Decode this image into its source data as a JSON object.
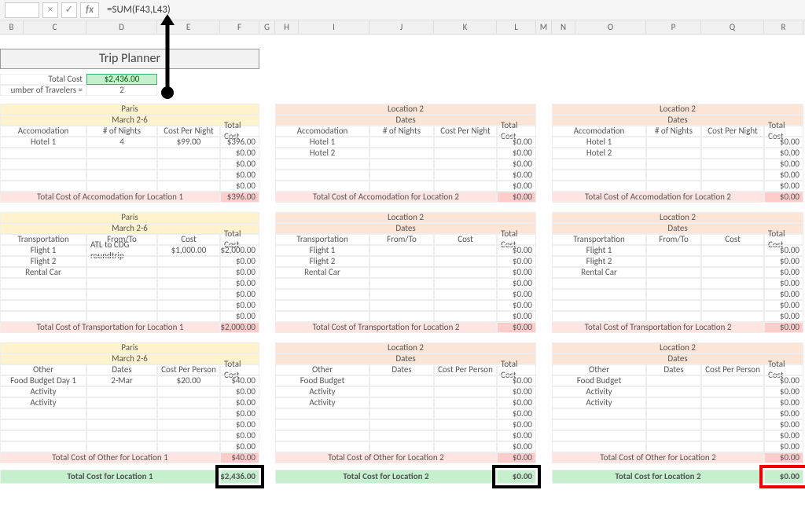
{
  "formula_bar": {
    "cell_ref": "",
    "formula": "=SUM(F43,L43)"
  },
  "columns": [
    "B",
    "C",
    "D",
    "E",
    "F",
    "G",
    "H",
    "I",
    "J",
    "K",
    "L",
    "M",
    "N",
    "O",
    "P",
    "Q",
    "R"
  ],
  "title": "Trip Planner",
  "summary": {
    "total_cost_label": "Total Cost",
    "total_cost": "$2,436.00",
    "travelers_label": "umber of Travelers  =",
    "travelers": "2"
  },
  "blocks": {
    "loc1_acc": {
      "loc": "Paris",
      "dates": "March 2-6",
      "h": [
        "Accomodation",
        "# of Nights",
        "Cost Per Night",
        "Total Cost"
      ],
      "rows": [
        [
          "Hotel 1",
          "4",
          "$99.00",
          "$396.00"
        ],
        [
          "",
          "",
          "",
          "$0.00"
        ],
        [
          "",
          "",
          "",
          "$0.00"
        ],
        [
          "",
          "",
          "",
          "$0.00"
        ],
        [
          "",
          "",
          "",
          "$0.00"
        ]
      ],
      "sub": "Total Cost of Accomodation for Location 1",
      "subv": "$396.00"
    },
    "loc2_acc": {
      "loc": "Location 2",
      "dates": "Dates",
      "h": [
        "Accomodation",
        "# of Nights",
        "Cost Per Night",
        "Total Cost"
      ],
      "rows": [
        [
          "Hotel 1",
          "",
          "",
          "$0.00"
        ],
        [
          "Hotel 2",
          "",
          "",
          "$0.00"
        ],
        [
          "",
          "",
          "",
          "$0.00"
        ],
        [
          "",
          "",
          "",
          "$0.00"
        ],
        [
          "",
          "",
          "",
          "$0.00"
        ]
      ],
      "sub": "Total Cost of Accomodation for Location 2",
      "subv": "$0.00"
    },
    "loc3_acc": {
      "loc": "Location 2",
      "dates": "Dates",
      "h": [
        "Accomodation",
        "# of Nights",
        "Cost Per Night",
        "Total Cost"
      ],
      "rows": [
        [
          "Hotel 1",
          "",
          "",
          "$0.00"
        ],
        [
          "Hotel 2",
          "",
          "",
          "$0.00"
        ],
        [
          "",
          "",
          "",
          "$0.00"
        ],
        [
          "",
          "",
          "",
          "$0.00"
        ],
        [
          "",
          "",
          "",
          "$0.00"
        ]
      ],
      "sub": "Total Cost of Accomodation for Location 2",
      "subv": "$0.00"
    },
    "loc1_tr": {
      "loc": "Paris",
      "dates": "March 2-6",
      "h": [
        "Transportation",
        "From/To",
        "Cost",
        "Total Cost"
      ],
      "rows": [
        [
          "Flight 1",
          "ATL to CDG roundtrip",
          "$1,000.00",
          "$2,000.00"
        ],
        [
          "Flight 2",
          "",
          "",
          "$0.00"
        ],
        [
          "Rental Car",
          "",
          "",
          "$0.00"
        ],
        [
          "",
          "",
          "",
          "$0.00"
        ],
        [
          "",
          "",
          "",
          "$0.00"
        ],
        [
          "",
          "",
          "",
          "$0.00"
        ],
        [
          "",
          "",
          "",
          "$0.00"
        ]
      ],
      "sub": "Total Cost of Transportation for Location 1",
      "subv": "$2,000.00"
    },
    "loc2_tr": {
      "loc": "Location 2",
      "dates": "Dates",
      "h": [
        "Transportation",
        "From/To",
        "Cost",
        "Total Cost"
      ],
      "rows": [
        [
          "Flight 1",
          "",
          "",
          "$0.00"
        ],
        [
          "Flight 2",
          "",
          "",
          "$0.00"
        ],
        [
          "Rental Car",
          "",
          "",
          "$0.00"
        ],
        [
          "",
          "",
          "",
          "$0.00"
        ],
        [
          "",
          "",
          "",
          "$0.00"
        ],
        [
          "",
          "",
          "",
          "$0.00"
        ],
        [
          "",
          "",
          "",
          "$0.00"
        ]
      ],
      "sub": "Total Cost of Transportation for Location 2",
      "subv": "$0.00"
    },
    "loc3_tr": {
      "loc": "Location 2",
      "dates": "Dates",
      "h": [
        "Transportation",
        "From/To",
        "Cost",
        "Total Cost"
      ],
      "rows": [
        [
          "Flight 1",
          "",
          "",
          "$0.00"
        ],
        [
          "Flight 2",
          "",
          "",
          "$0.00"
        ],
        [
          "Rental Car",
          "",
          "",
          "$0.00"
        ],
        [
          "",
          "",
          "",
          "$0.00"
        ],
        [
          "",
          "",
          "",
          "$0.00"
        ],
        [
          "",
          "",
          "",
          "$0.00"
        ],
        [
          "",
          "",
          "",
          "$0.00"
        ]
      ],
      "sub": "Total Cost of Transportation for Location 2",
      "subv": "$0.00"
    },
    "loc1_ot": {
      "loc": "Paris",
      "dates": "March 2-6",
      "h": [
        "Other",
        "Dates",
        "Cost Per Person",
        "Total Cost"
      ],
      "rows": [
        [
          "Food Budget Day 1",
          "2-Mar",
          "$20.00",
          "$40.00"
        ],
        [
          "Activity",
          "",
          "",
          "$0.00"
        ],
        [
          "Activity",
          "",
          "",
          "$0.00"
        ],
        [
          "",
          "",
          "",
          "$0.00"
        ],
        [
          "",
          "",
          "",
          "$0.00"
        ],
        [
          "",
          "",
          "",
          "$0.00"
        ],
        [
          "",
          "",
          "",
          "$0.00"
        ]
      ],
      "sub": "Total Cost of Other for Location 1",
      "subv": "$40.00"
    },
    "loc2_ot": {
      "loc": "Location 2",
      "dates": "Dates",
      "h": [
        "Other",
        "Dates",
        "Cost Per Person",
        "Total Cost"
      ],
      "rows": [
        [
          "Food Budget",
          "",
          "",
          "$0.00"
        ],
        [
          "Activity",
          "",
          "",
          "$0.00"
        ],
        [
          "Activity",
          "",
          "",
          "$0.00"
        ],
        [
          "",
          "",
          "",
          "$0.00"
        ],
        [
          "",
          "",
          "",
          "$0.00"
        ],
        [
          "",
          "",
          "",
          "$0.00"
        ],
        [
          "",
          "",
          "",
          "$0.00"
        ]
      ],
      "sub": "Total Cost of Other for Location 2",
      "subv": "$0.00"
    },
    "loc3_ot": {
      "loc": "Location 2",
      "dates": "Dates",
      "h": [
        "Other",
        "Dates",
        "Cost Per Person",
        "Total Cost"
      ],
      "rows": [
        [
          "Food Budget",
          "",
          "",
          "$0.00"
        ],
        [
          "Activity",
          "",
          "",
          "$0.00"
        ],
        [
          "Activity",
          "",
          "",
          "$0.00"
        ],
        [
          "",
          "",
          "",
          "$0.00"
        ],
        [
          "",
          "",
          "",
          "$0.00"
        ],
        [
          "",
          "",
          "",
          "$0.00"
        ],
        [
          "",
          "",
          "",
          "$0.00"
        ]
      ],
      "sub": "Total Cost of Other for Location 2",
      "subv": "$0.00"
    }
  },
  "totals": [
    {
      "label": "Total Cost for Location 1",
      "val": "$2,436.00"
    },
    {
      "label": "Total Cost for Location 2",
      "val": "$0.00"
    },
    {
      "label": "Total Cost for Location 2",
      "val": "$0.00"
    }
  ]
}
